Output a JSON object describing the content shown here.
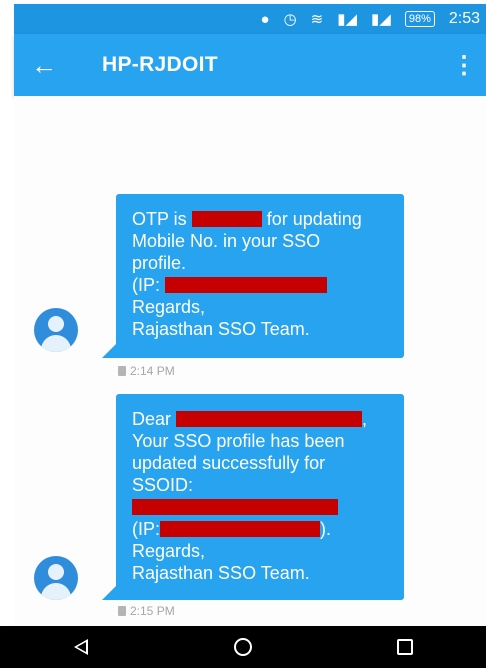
{
  "status_bar": {
    "icons": [
      "location-icon",
      "alarm-icon",
      "wifi-icon",
      "signal-icon",
      "signal-icon"
    ],
    "battery": "98%",
    "time": "2:53"
  },
  "toolbar": {
    "title": "HP-RJDOIT",
    "back_icon": "arrow-left-icon",
    "menu_icon": "more-vert-icon"
  },
  "messages": [
    {
      "lines": {
        "l1_pre": "OTP is",
        "l1_post": "for updating",
        "l2": "Mobile No. in your SSO",
        "l3": "profile.",
        "l4_pre": "(IP:",
        "l5": "Regards,",
        "l6": "Rajasthan SSO Team."
      },
      "time": "2:14 PM"
    },
    {
      "lines": {
        "l1_pre": "Dear",
        "l1_post": ",",
        "l2": "Your SSO profile has been",
        "l3": "updated successfully for",
        "l4": "SSOID:",
        "l6_pre": "(IP:",
        "l6_post": ").",
        "l7": "Regards,",
        "l8": "Rajasthan SSO Team."
      },
      "time": "2:15 PM"
    }
  ],
  "colors": {
    "status_bar": "#1e95e0",
    "toolbar": "#27a3ef",
    "bubble": "#27a3ef",
    "redaction": "#c60000",
    "avatar": "#2f8ddb"
  }
}
